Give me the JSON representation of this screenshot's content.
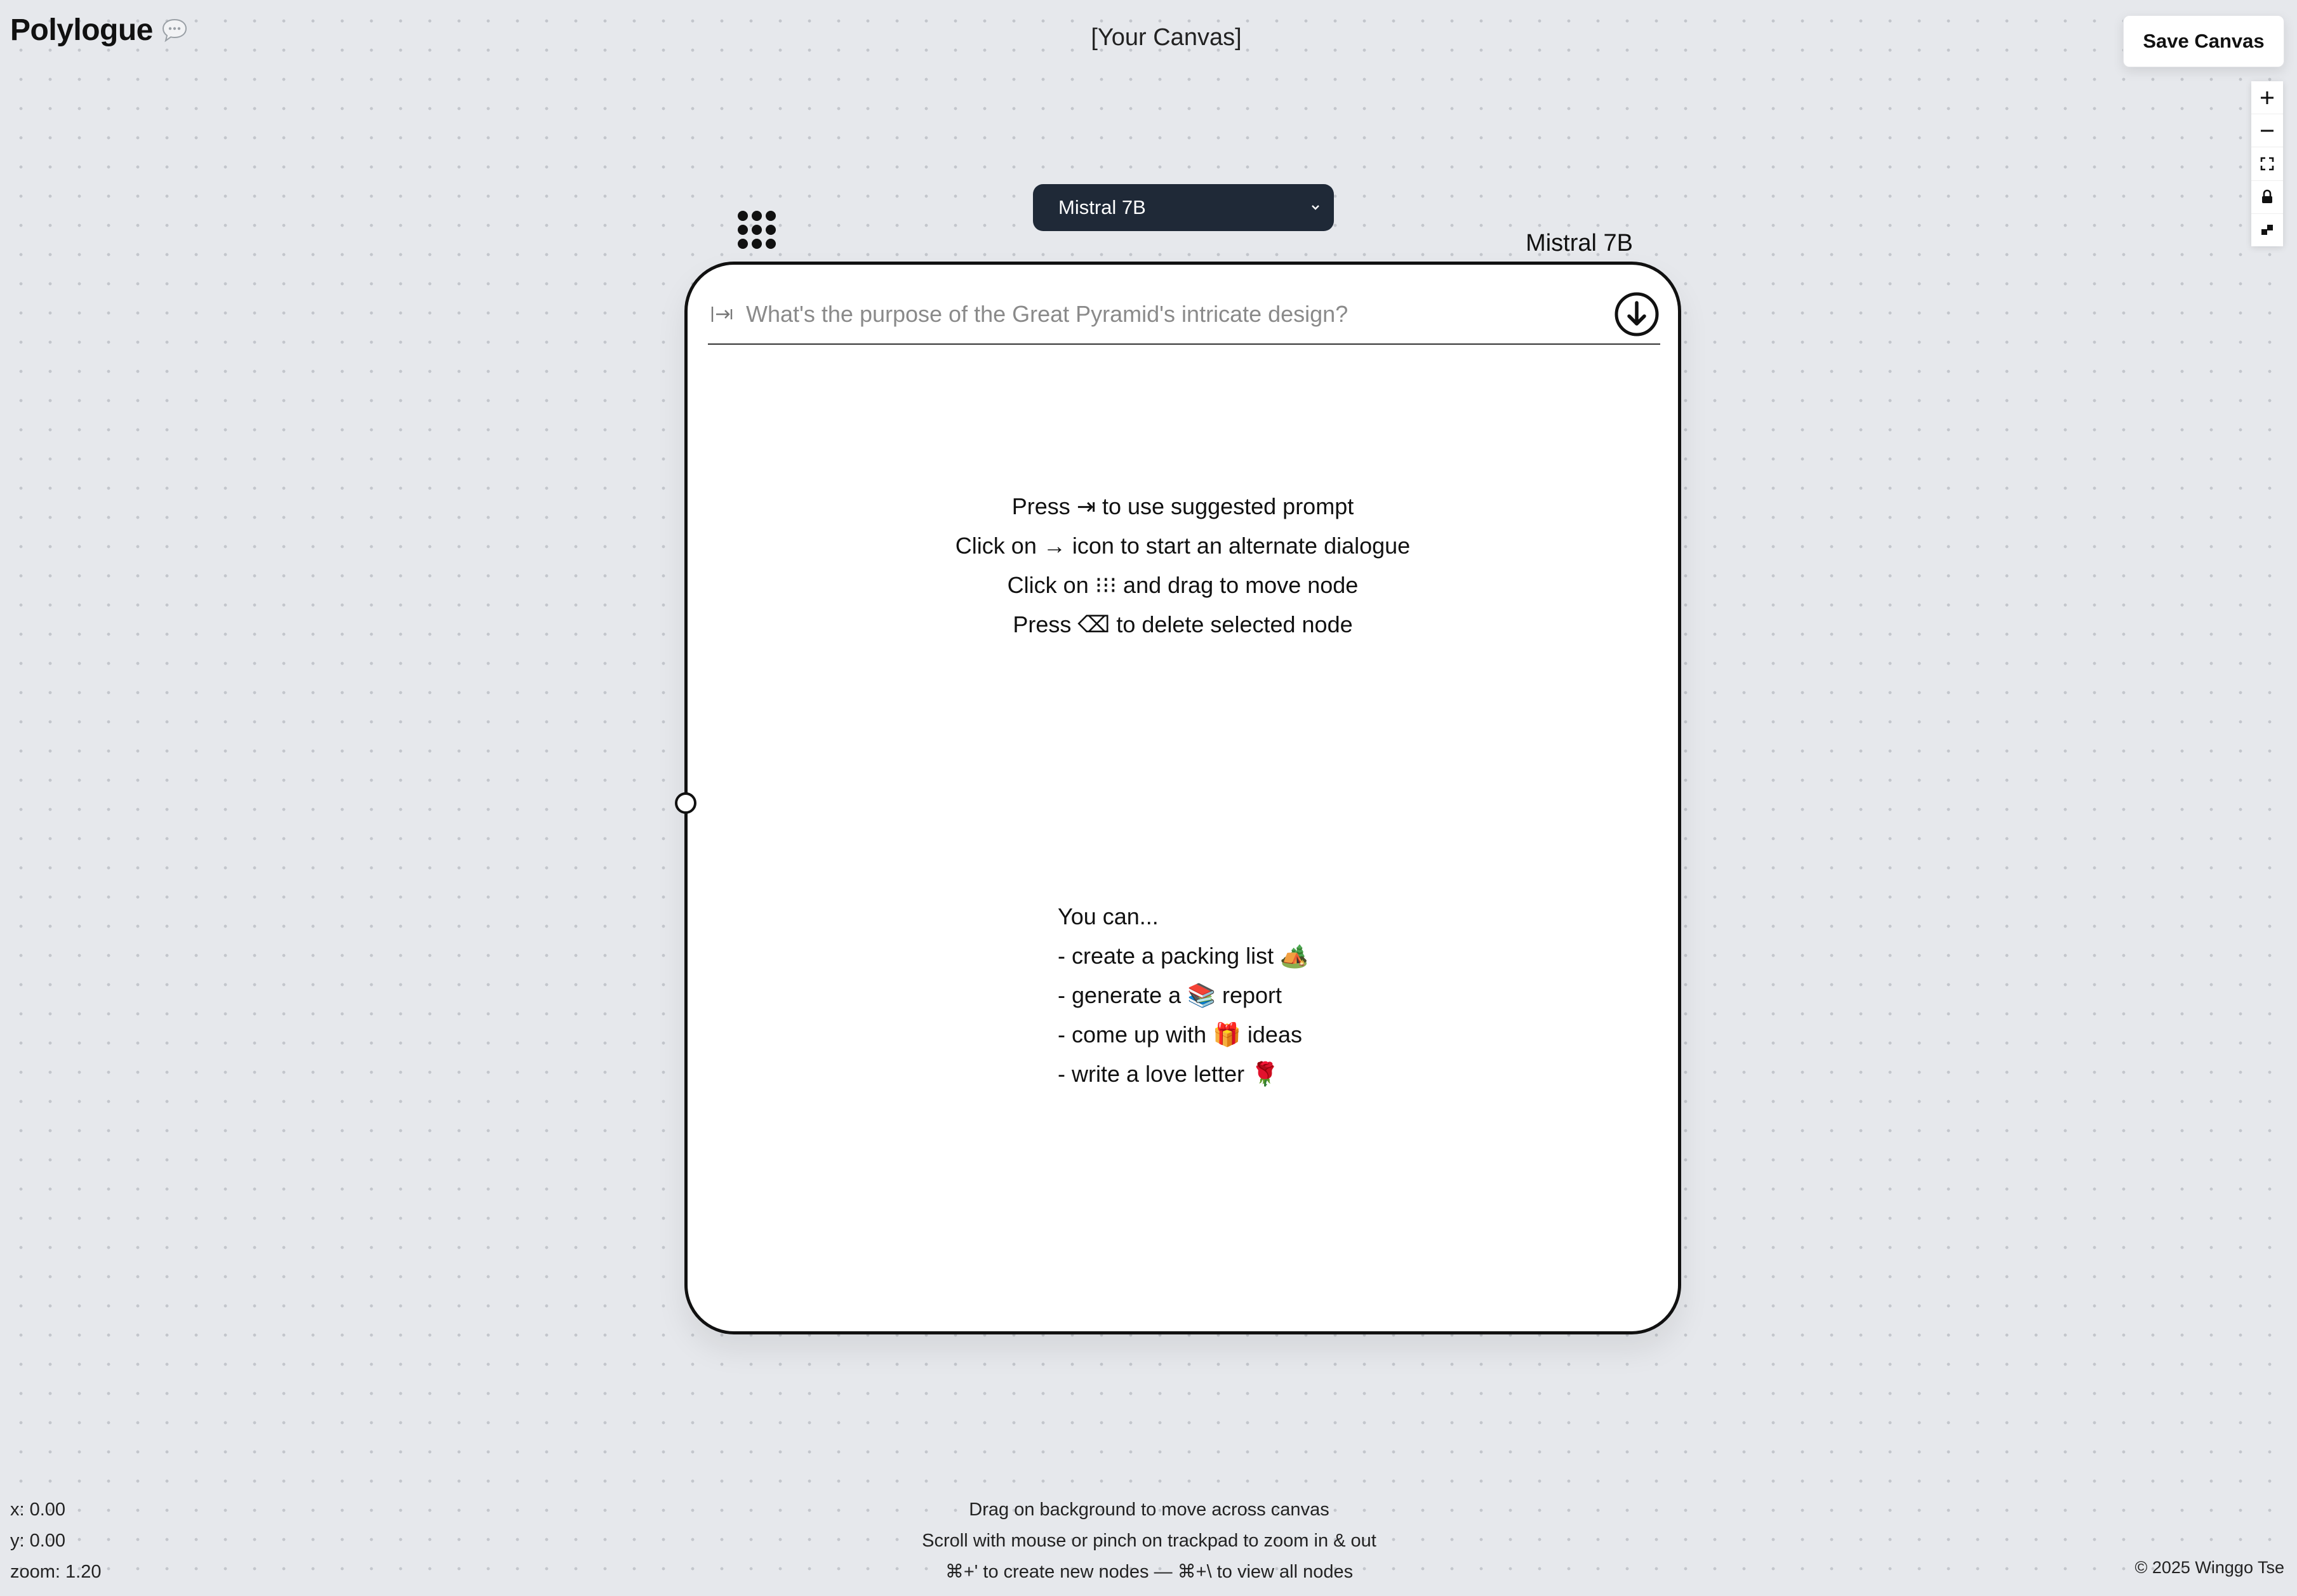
{
  "app": {
    "name": "Polylogue",
    "logo_icon": "speech-bubble-icon"
  },
  "header": {
    "canvas_title": "[Your Canvas]",
    "save_label": "Save Canvas"
  },
  "zoom_controls": [
    {
      "name": "zoom-in",
      "icon": "plus-icon"
    },
    {
      "name": "zoom-out",
      "icon": "minus-icon"
    },
    {
      "name": "fit-view",
      "icon": "fit-view-icon"
    },
    {
      "name": "lock",
      "icon": "lock-icon"
    },
    {
      "name": "minimap",
      "icon": "minimap-icon"
    }
  ],
  "model_select": {
    "selected": "Mistral 7B",
    "icon": "chevron-down-icon"
  },
  "node": {
    "model_label": "Mistral 7B",
    "prompt_placeholder": "What's the purpose of the Great Pyramid's intricate design?",
    "prompt_value": "",
    "tab_icon": "tab-key-icon",
    "submit_icon": "arrow-down-circle-icon",
    "help_lines": [
      "Press ⇥ to use suggested prompt",
      "Click on → icon to start an alternate dialogue",
      "Click on ⁝⁝⁝ and drag to move node",
      "Press ⌫ to delete selected node"
    ],
    "suggestions": {
      "heading": "You can...",
      "items": [
        "- create a packing list 🏕️",
        "- generate a 📚 report",
        "- come up with 🎁 ideas",
        "- write a love letter 🌹"
      ]
    }
  },
  "status": {
    "x": "x: 0.00",
    "y": "y: 0.00",
    "zoom": "zoom: 1.20"
  },
  "tips": [
    "Drag on background to move across canvas",
    "Scroll with mouse or pinch on trackpad to zoom in & out",
    "⌘+' to create new nodes — ⌘+\\ to view all nodes"
  ],
  "footer": {
    "copyright": "© 2025 Winggo Tse"
  },
  "colors": {
    "background": "#e6e8ec",
    "dropdown_bg": "#1f2937",
    "node_border": "#111111",
    "placeholder": "#8a8a8a"
  }
}
